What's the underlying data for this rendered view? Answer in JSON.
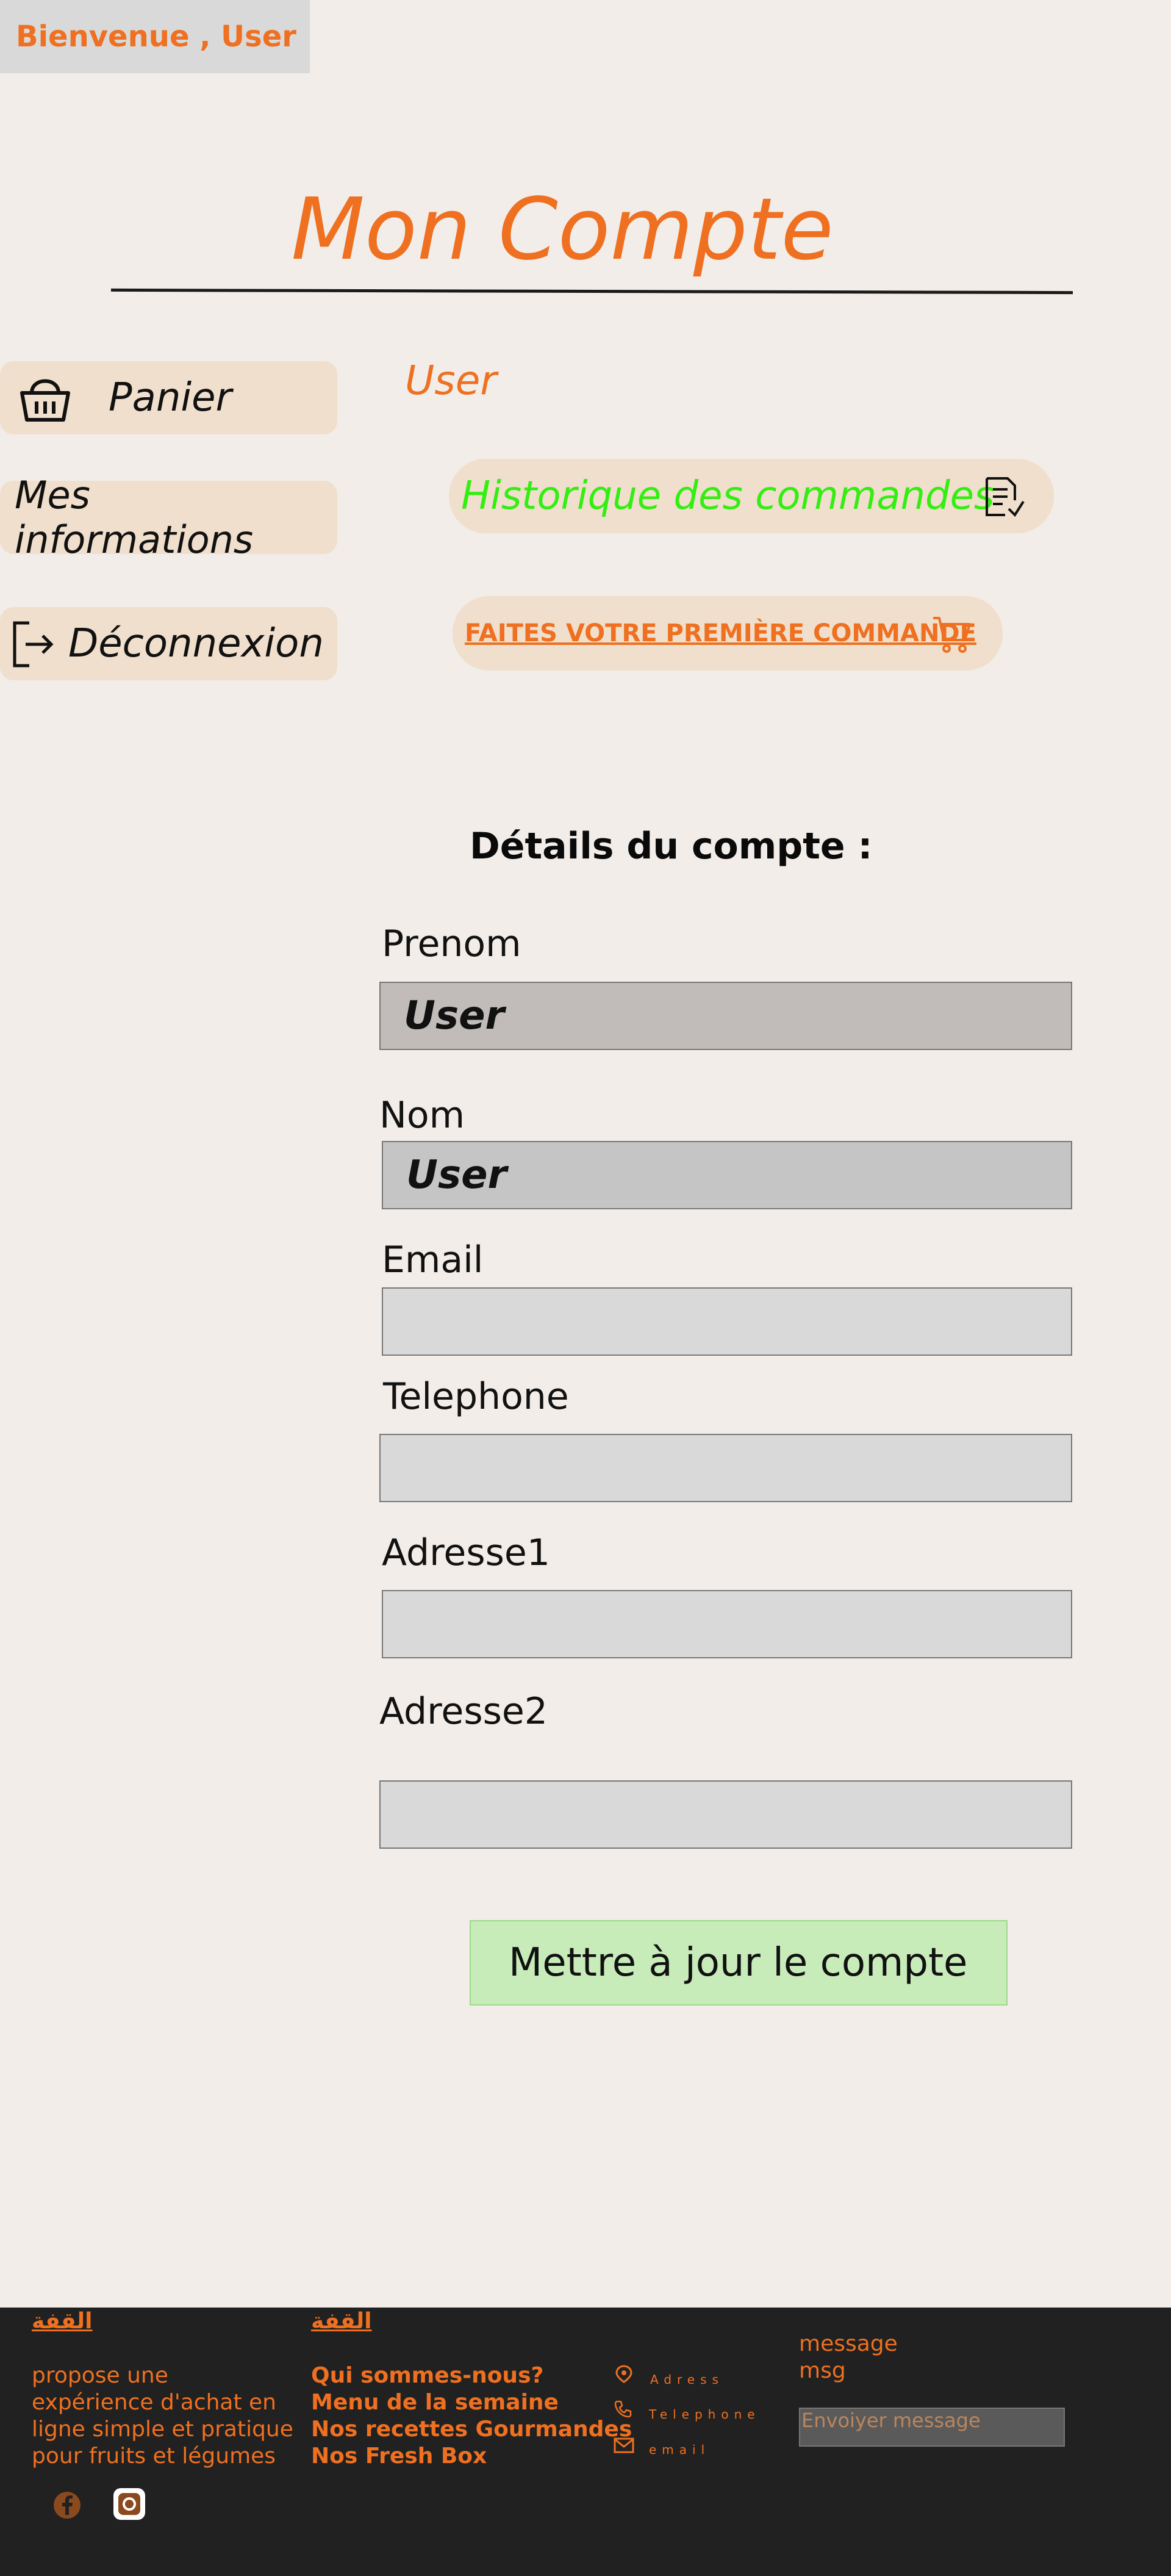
{
  "header": {
    "welcome": "Bienvenue , User"
  },
  "page": {
    "title": "Mon Compte"
  },
  "sidebar": {
    "items": [
      {
        "label": "Panier",
        "icon": "basket-icon"
      },
      {
        "label": "Mes informations"
      },
      {
        "label": "Déconnexion",
        "icon": "logout-icon"
      }
    ]
  },
  "account": {
    "username": "User",
    "history_button": "Historique des commandes",
    "first_order_button": "FAITES VOTRE PREMIÈRE COMMANDE"
  },
  "details": {
    "title": "Détails du compte :",
    "fields": {
      "prenom": {
        "label": "Prenom",
        "value": "User"
      },
      "nom": {
        "label": "Nom",
        "value": "User"
      },
      "email": {
        "label": "Email",
        "value": ""
      },
      "telephone": {
        "label": "Telephone",
        "value": ""
      },
      "adresse1": {
        "label": "Adresse1",
        "value": ""
      },
      "adresse2": {
        "label": "Adresse2",
        "value": ""
      }
    },
    "submit": "Mettre à jour le compte"
  },
  "footer": {
    "brand_1": "القفة",
    "brand_2": "القفة",
    "description": "propose une expérience d'achat en ligne simple et pratique pour fruits et légumes",
    "links": [
      "Qui sommes-nous?",
      "Menu de la semaine",
      "Nos recettes Gourmandes",
      "Nos Fresh Box"
    ],
    "contact": {
      "address": "Adress",
      "phone": "Telephone",
      "email": "email"
    },
    "message_label_1": "message",
    "message_label_2": "msg",
    "message_placeholder": "Envoiyer message"
  },
  "colors": {
    "accent": "#ee7020",
    "history_green": "#33ee11",
    "footer_bg": "#212121",
    "pill_bg": "#f0dfcc"
  }
}
